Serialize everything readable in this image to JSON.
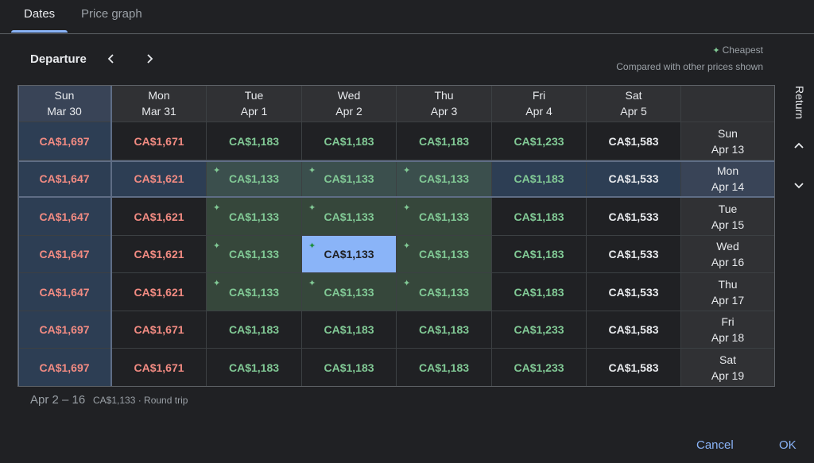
{
  "tabs": [
    {
      "label": "Dates",
      "active": true
    },
    {
      "label": "Price graph",
      "active": false
    }
  ],
  "departure_label": "Departure",
  "legend": {
    "cheapest": "Cheapest",
    "note": "Compared with other prices shown"
  },
  "return_label": "Return",
  "columns": [
    {
      "day": "Sun",
      "date": "Mar 30"
    },
    {
      "day": "Mon",
      "date": "Mar 31"
    },
    {
      "day": "Tue",
      "date": "Apr 1"
    },
    {
      "day": "Wed",
      "date": "Apr 2"
    },
    {
      "day": "Thu",
      "date": "Apr 3"
    },
    {
      "day": "Fri",
      "date": "Apr 4"
    },
    {
      "day": "Sat",
      "date": "Apr 5"
    }
  ],
  "rows": [
    {
      "day": "Sun",
      "date": "Apr 13",
      "prices": [
        "CA$1,697",
        "CA$1,671",
        "CA$1,183",
        "CA$1,183",
        "CA$1,183",
        "CA$1,233",
        "CA$1,583"
      ]
    },
    {
      "day": "Mon",
      "date": "Apr 14",
      "prices": [
        "CA$1,647",
        "CA$1,621",
        "CA$1,133",
        "CA$1,133",
        "CA$1,133",
        "CA$1,183",
        "CA$1,533"
      ]
    },
    {
      "day": "Tue",
      "date": "Apr 15",
      "prices": [
        "CA$1,647",
        "CA$1,621",
        "CA$1,133",
        "CA$1,133",
        "CA$1,133",
        "CA$1,183",
        "CA$1,533"
      ]
    },
    {
      "day": "Wed",
      "date": "Apr 16",
      "prices": [
        "CA$1,647",
        "CA$1,621",
        "CA$1,133",
        "CA$1,133",
        "CA$1,133",
        "CA$1,183",
        "CA$1,533"
      ]
    },
    {
      "day": "Thu",
      "date": "Apr 17",
      "prices": [
        "CA$1,647",
        "CA$1,621",
        "CA$1,133",
        "CA$1,133",
        "CA$1,133",
        "CA$1,183",
        "CA$1,533"
      ]
    },
    {
      "day": "Fri",
      "date": "Apr 18",
      "prices": [
        "CA$1,697",
        "CA$1,671",
        "CA$1,183",
        "CA$1,183",
        "CA$1,183",
        "CA$1,233",
        "CA$1,583"
      ]
    },
    {
      "day": "Sat",
      "date": "Apr 19",
      "prices": [
        "CA$1,697",
        "CA$1,671",
        "CA$1,183",
        "CA$1,183",
        "CA$1,183",
        "CA$1,233",
        "CA$1,583"
      ]
    }
  ],
  "price_colors": [
    "red",
    "red",
    "green",
    "green",
    "green",
    "green",
    "white"
  ],
  "selected": {
    "row": 3,
    "col": 3
  },
  "highlight_row": 1,
  "highlight_col": 0,
  "summary": {
    "range": "Apr 2 – 16",
    "price": "CA$1,133 · Round trip"
  },
  "buttons": {
    "cancel": "Cancel",
    "ok": "OK"
  },
  "colors": {
    "red": "#f28b82",
    "green": "#81c995",
    "accent": "#8ab4f8",
    "background": "#202124"
  }
}
